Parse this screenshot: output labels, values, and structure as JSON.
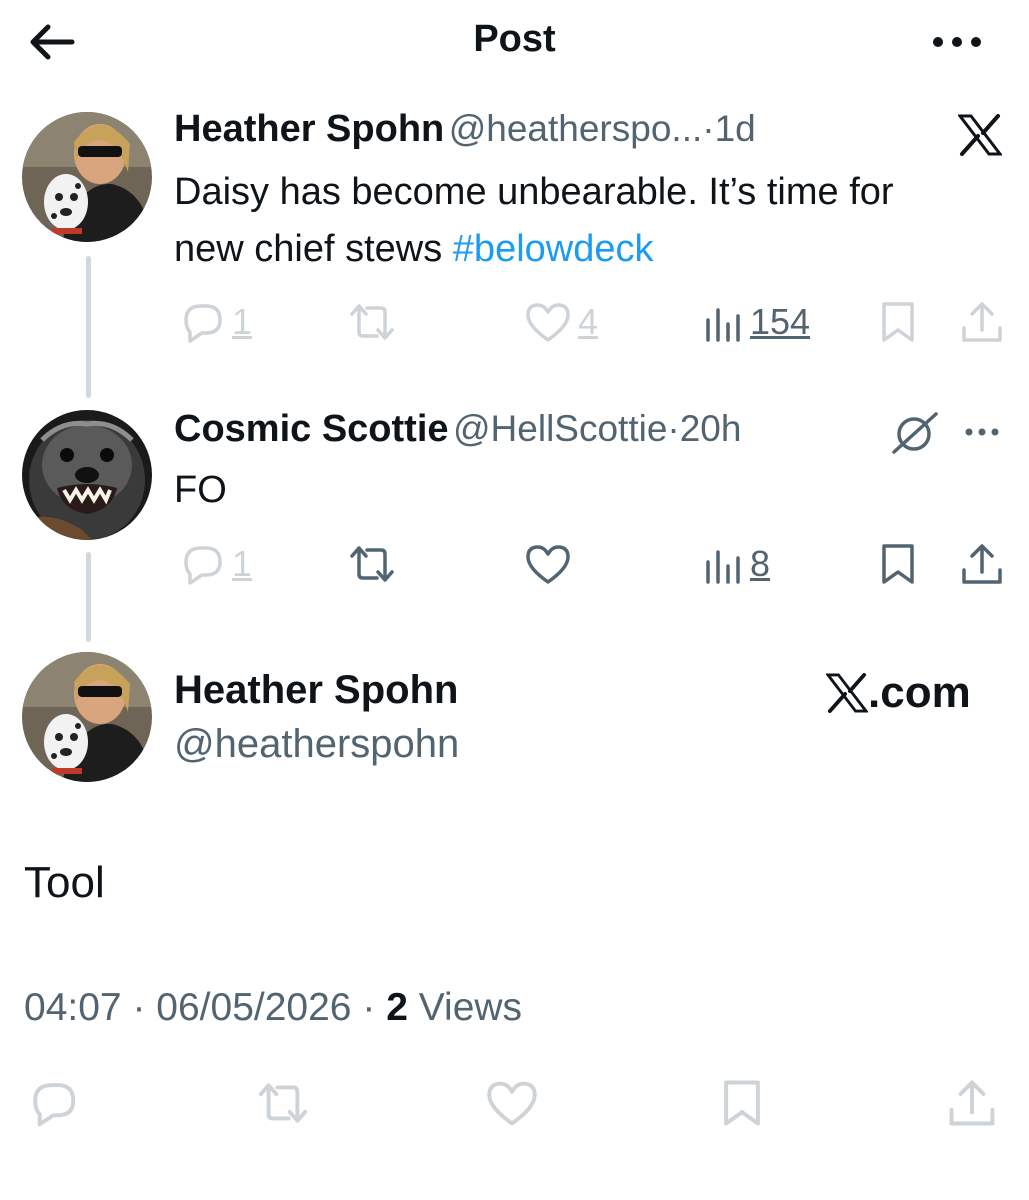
{
  "header": {
    "title": "Post"
  },
  "tweets": [
    {
      "name": "Heather Spohn",
      "handle": "@heatherspo...",
      "separator": "·",
      "time": "1d",
      "text": "Daisy has become unbearable. It’s time for",
      "text_line2": "new chief stews ",
      "hashtag": "#belowdeck",
      "replies": "1",
      "likes": "4",
      "views": "154"
    },
    {
      "name": "Cosmic Scottie",
      "handle": "@HellScottie",
      "separator": "·",
      "time": "20h",
      "text": "FO",
      "replies": "1",
      "views": "8"
    }
  ],
  "main_post": {
    "name": "Heather Spohn",
    "handle": "@heatherspohn",
    "brand": ".com",
    "text": "Tool",
    "time": "04:07",
    "date": "06/05/2026",
    "separator": "·",
    "views_count": "2",
    "views_label": "Views"
  },
  "colors": {
    "text": "#0f1419",
    "secondary": "#536471",
    "link": "#1d9bf0",
    "thread_line": "#cfd9de",
    "action_faded": "#c7d6e0"
  },
  "icons": [
    "back-arrow-icon",
    "more-icon",
    "x-logo-icon",
    "reply-icon",
    "retweet-icon",
    "like-icon",
    "views-icon",
    "bookmark-icon",
    "share-icon",
    "grok-icon"
  ]
}
